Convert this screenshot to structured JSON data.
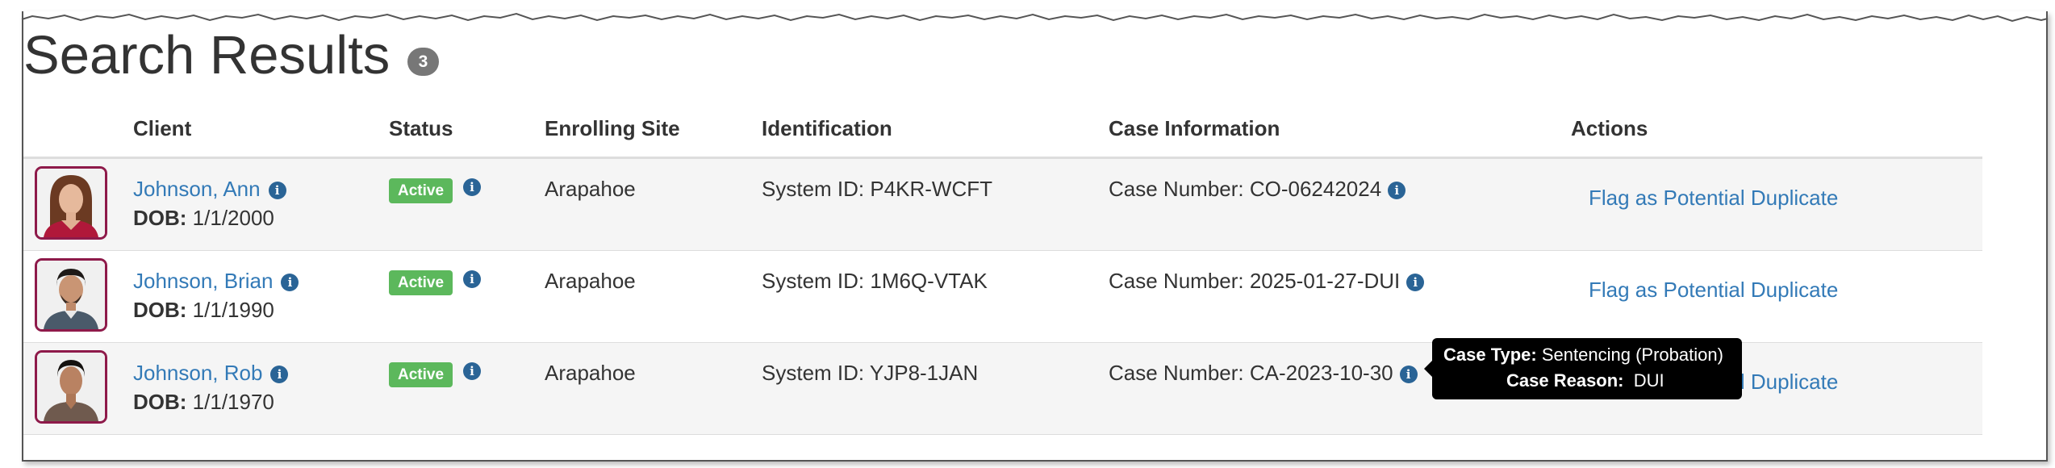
{
  "page": {
    "title": "Search Results",
    "result_count": "3"
  },
  "columns": {
    "client": "Client",
    "status": "Status",
    "enrolling_site": "Enrolling Site",
    "identification": "Identification",
    "case_information": "Case Information",
    "actions": "Actions"
  },
  "rows": [
    {
      "name": "Johnson, Ann",
      "dob_label": "DOB:",
      "dob": "1/1/2000",
      "status": "Active",
      "site": "Arapahoe",
      "identification": "System ID: P4KR-WCFT",
      "case": "Case Number: CO-06242024",
      "action": "Flag as Potential Duplicate"
    },
    {
      "name": "Johnson, Brian",
      "dob_label": "DOB:",
      "dob": "1/1/1990",
      "status": "Active",
      "site": "Arapahoe",
      "identification": "System ID: 1M6Q-VTAK",
      "case": "Case Number: 2025-01-27-DUI",
      "action": "Flag as Potential Duplicate"
    },
    {
      "name": "Johnson, Rob",
      "dob_label": "DOB:",
      "dob": "1/1/1970",
      "status": "Active",
      "site": "Arapahoe",
      "identification": "System ID: YJP8-1JAN",
      "case": "Case Number: CA-2023-10-30",
      "action": "Flag as Potential Duplicate"
    }
  ],
  "tooltip": {
    "type_label": "Case Type:",
    "type_value": "Sentencing (Probation)",
    "reason_label": "Case Reason:",
    "reason_value": "DUI"
  },
  "icons": {
    "info": "info-icon",
    "info_glyph": "i"
  },
  "colors": {
    "link": "#337ab7",
    "active_badge": "#5cb85c",
    "avatar_border": "#8e1a4a",
    "count_badge": "#777777",
    "info_icon": "#2a6496",
    "row_stripe": "#f5f5f5",
    "tooltip_bg": "#000000"
  }
}
